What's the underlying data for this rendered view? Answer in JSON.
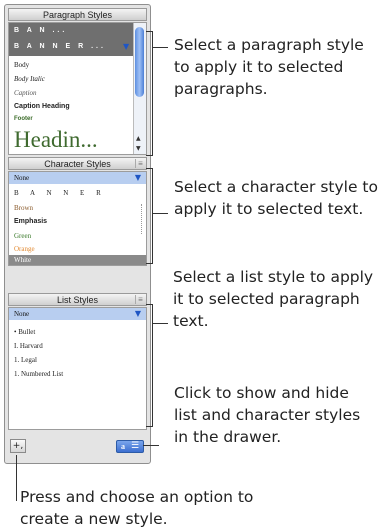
{
  "paragraph_styles": {
    "header": "Paragraph Styles",
    "items": [
      "B A N ...",
      "B A N N E R ...",
      "Body",
      "Body Italic",
      "Caption",
      "Caption Heading",
      "Footer",
      "Headin..."
    ]
  },
  "character_styles": {
    "header": "Character Styles",
    "selected": "None",
    "items": [
      "B A N N E R",
      "Brown",
      "Emphasis",
      "Green",
      "Orange",
      "White"
    ]
  },
  "list_styles": {
    "header": "List Styles",
    "selected": "None",
    "items": [
      "• Bullet",
      "I. Harvard",
      "1. Legal",
      "1. Numbered List"
    ]
  },
  "footer": {
    "add_button": "+,"
  },
  "callouts": {
    "paragraph": "Select a paragraph style to apply it to selected paragraphs.",
    "character": "Select a character style to apply it to selected text.",
    "list": "Select a list style to apply it to selected paragraph text.",
    "toggle": "Click to show and hide list and character styles in the drawer.",
    "new_style": "Press and choose an option to create a new style."
  }
}
